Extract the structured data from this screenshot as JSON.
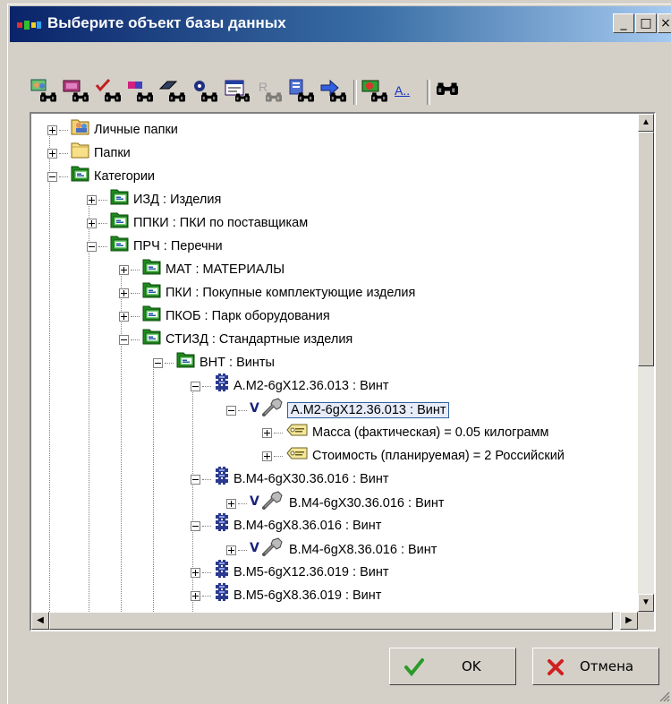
{
  "window": {
    "title": "Выберите объект базы данных",
    "minimize_glyph": "_",
    "maximize_glyph": "□",
    "close_glyph": "×"
  },
  "toolbar": {
    "items": [
      {
        "icon": "binoculars-users-icon"
      },
      {
        "icon": "binoculars-folder-icon"
      },
      {
        "icon": "binoculars-check-icon"
      },
      {
        "icon": "binoculars-box-icon"
      },
      {
        "icon": "binoculars-blocks-icon"
      },
      {
        "icon": "binoculars-gear-icon"
      },
      {
        "icon": "binoculars-form-icon"
      },
      {
        "icon": "binoculars-disabled-icon"
      },
      {
        "icon": "binoculars-document-icon"
      },
      {
        "icon": "binoculars-arrow-icon"
      },
      {
        "icon": "binoculars-find-icon"
      },
      {
        "icon": "text-filter-icon",
        "label": "A.."
      },
      {
        "icon": "binoculars-icon"
      }
    ]
  },
  "tree": {
    "rows": [
      {
        "text": "Личные папки",
        "icon": "personal-folder-icon",
        "expander": "plus"
      },
      {
        "text": "Папки",
        "icon": "folder-icon",
        "expander": "plus"
      },
      {
        "text": "Категории",
        "icon": "category-folder-icon",
        "expander": "minus"
      },
      {
        "text": "ИЗД : Изделия",
        "icon": "category-folder-icon",
        "expander": "plus"
      },
      {
        "text": "ППКИ : ПКИ по поставщикам",
        "icon": "category-folder-icon",
        "expander": "plus"
      },
      {
        "text": "ПРЧ : Перечни",
        "icon": "category-folder-icon",
        "expander": "minus"
      },
      {
        "text": "МАТ : МАТЕРИАЛЫ",
        "icon": "category-folder-icon",
        "expander": "plus"
      },
      {
        "text": "ПКИ : Покупные комплектующие изделия",
        "icon": "category-folder-icon",
        "expander": "plus"
      },
      {
        "text": "ПКОБ : Парк оборудования",
        "icon": "category-folder-icon",
        "expander": "plus"
      },
      {
        "text": "СТИЗД : Стандартные изделия",
        "icon": "category-folder-icon",
        "expander": "minus"
      },
      {
        "text": "ВНТ : Винты",
        "icon": "category-folder-icon",
        "expander": "minus"
      },
      {
        "text": "А.М2-6gX12.36.013 : Винт",
        "icon": "object-icon",
        "expander": "minus"
      },
      {
        "text": "А.М2-6gX12.36.013 : Винт",
        "icon": "version-tool-icon",
        "expander": "minus",
        "selected": true
      },
      {
        "text": "Масса (фактическая) = 0.05 килограмм",
        "icon": "attribute-icon",
        "expander": "plus"
      },
      {
        "text": "Стоимость (планируемая) = 2 Российский",
        "icon": "attribute-icon",
        "expander": "plus"
      },
      {
        "text": "В.М4-6gX30.36.016 : Винт",
        "icon": "object-icon",
        "expander": "minus"
      },
      {
        "text": "В.М4-6gX30.36.016 : Винт",
        "icon": "version-tool-icon",
        "expander": "plus"
      },
      {
        "text": "В.М4-6gX8.36.016 : Винт",
        "icon": "object-icon",
        "expander": "minus"
      },
      {
        "text": "В.М4-6gX8.36.016 : Винт",
        "icon": "version-tool-icon",
        "expander": "plus"
      },
      {
        "text": "В.М5-6gX12.36.019 : Винт",
        "icon": "object-icon",
        "expander": "plus"
      },
      {
        "text": "В.М5-6gX8.36.019 : Винт",
        "icon": "object-icon",
        "expander": "plus"
      }
    ]
  },
  "buttons": {
    "ok": {
      "label": "OK",
      "icon": "check-icon"
    },
    "cancel": {
      "label": "Отмена",
      "icon": "cross-icon"
    }
  },
  "colors": {
    "title_start": "#0a246a",
    "title_end": "#a6caf0",
    "selection_border": "#3060a0",
    "category_green": "#2e9a2e"
  }
}
